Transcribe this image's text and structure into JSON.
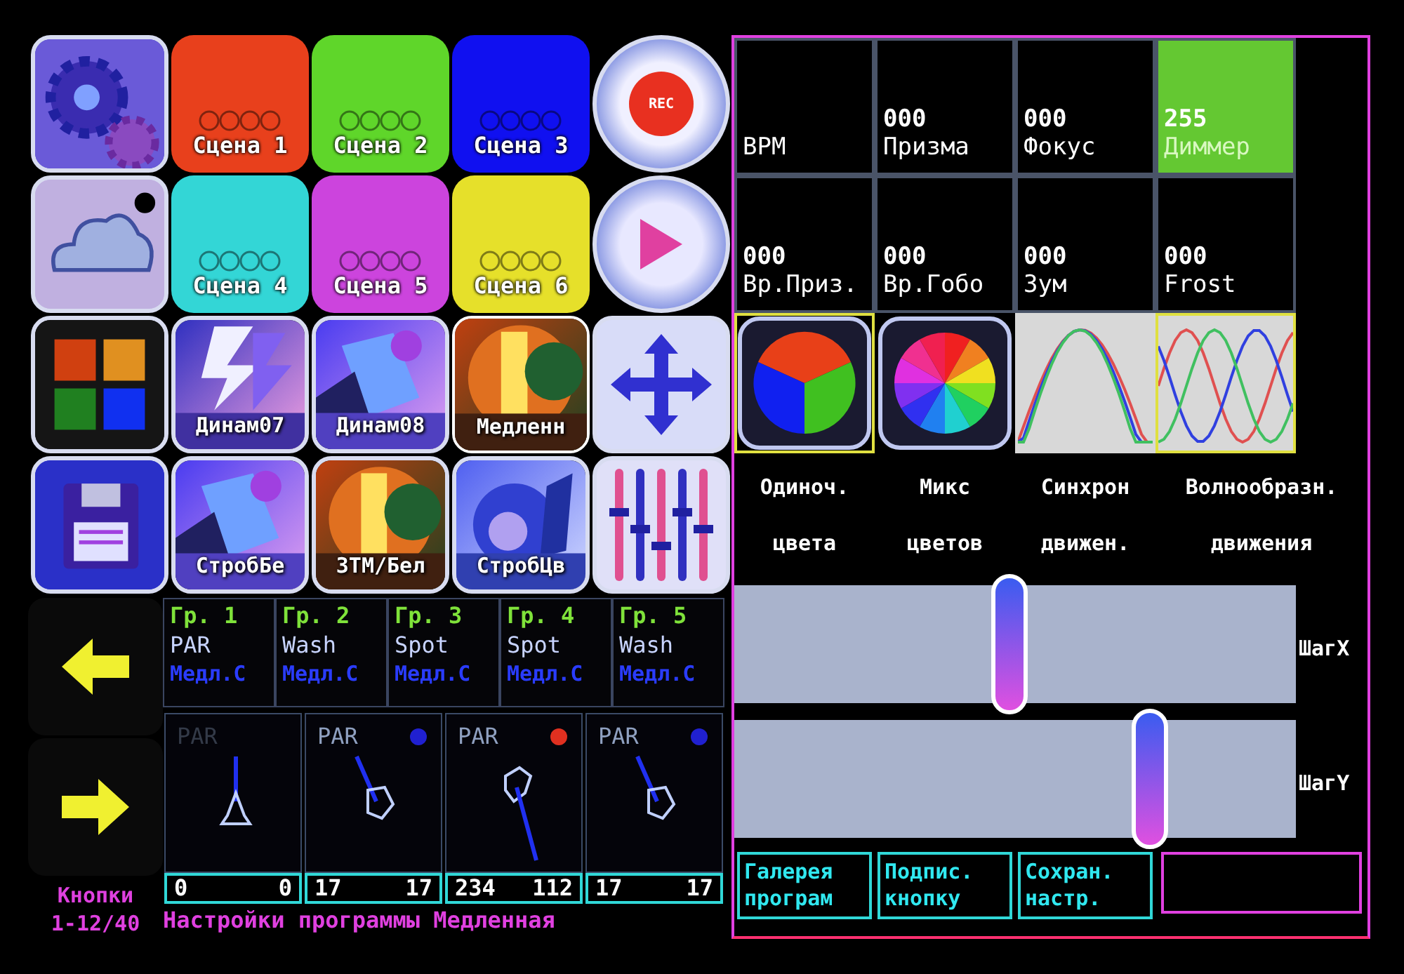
{
  "tiles": [
    {
      "kind": "settings"
    },
    {
      "kind": "scene",
      "label": "Сцена 1",
      "color": "#e8401c"
    },
    {
      "kind": "scene",
      "label": "Сцена 2",
      "color": "#5fd62a"
    },
    {
      "kind": "scene",
      "label": "Сцена 3",
      "color": "#1010f0"
    },
    {
      "kind": "rec",
      "label": "REC"
    },
    {
      "kind": "cloud"
    },
    {
      "kind": "scene",
      "label": "Сцена 4",
      "color": "#33d6d6"
    },
    {
      "kind": "scene",
      "label": "Сцена 5",
      "color": "#cc44dd"
    },
    {
      "kind": "scene",
      "label": "Сцена 6",
      "color": "#e6e02a"
    },
    {
      "kind": "play"
    },
    {
      "kind": "palette"
    },
    {
      "kind": "program",
      "label": "Динам07",
      "selected": false
    },
    {
      "kind": "program",
      "label": "Динам08",
      "selected": false
    },
    {
      "kind": "program",
      "label": "Медленн",
      "selected": true
    },
    {
      "kind": "move"
    },
    {
      "kind": "save"
    },
    {
      "kind": "program",
      "label": "СтробБе",
      "selected": false
    },
    {
      "kind": "program",
      "label": "ЗТМ/Бел",
      "selected": false
    },
    {
      "kind": "program",
      "label": "СтробЦв",
      "selected": false
    },
    {
      "kind": "mixer"
    }
  ],
  "page_label": "Кнопки 1-12/40",
  "groups": [
    {
      "title": "Гр. 1",
      "type": "PAR",
      "program": "Медл.С"
    },
    {
      "title": "Гр. 2",
      "type": "Wash",
      "program": "Медл.С"
    },
    {
      "title": "Гр. 3",
      "type": "Spot",
      "program": "Медл.С"
    },
    {
      "title": "Гр. 4",
      "type": "Spot",
      "program": "Медл.С"
    },
    {
      "title": "Гр. 5",
      "type": "Wash",
      "program": "Медл.С"
    }
  ],
  "channels": [
    {
      "label": "PAR",
      "dimmed": true,
      "pan": "0",
      "tilt": "0"
    },
    {
      "label": "PAR",
      "dimmed": false,
      "color": "#2020d0",
      "pan": "17",
      "tilt": "17"
    },
    {
      "label": "PAR",
      "dimmed": false,
      "color": "#e03020",
      "pan": "234",
      "tilt": "112"
    },
    {
      "label": "PAR",
      "dimmed": false,
      "color": "#2020d0",
      "pan": "17",
      "tilt": "17"
    }
  ],
  "status": "Настройки программы Медленная",
  "params": [
    {
      "label": "BPM",
      "active": false
    },
    {
      "value": "000",
      "label": "Призма",
      "active": false
    },
    {
      "value": "000",
      "label": "Фокус",
      "active": false
    },
    {
      "value": "255",
      "label": "Диммер",
      "active": true
    },
    {
      "value": "000",
      "label": "Вр.Приз.",
      "active": false
    },
    {
      "value": "000",
      "label": "Вр.Гобо",
      "active": false
    },
    {
      "value": "000",
      "label": "Зум",
      "active": false
    },
    {
      "value": "000",
      "label": "Frost",
      "active": false
    }
  ],
  "modes": [
    {
      "kind": "single_color",
      "title": "Одиноч.",
      "subtitle": "цвета",
      "selected": true
    },
    {
      "kind": "mix_color",
      "title": "Микс",
      "subtitle": "цветов",
      "selected": false
    },
    {
      "kind": "sync_wave",
      "title": "Синхрон",
      "subtitle": "движен.",
      "selected": false
    },
    {
      "kind": "wave",
      "title": "Волнообразн.",
      "subtitle": "движения",
      "selected": true
    }
  ],
  "sliders": [
    {
      "label": "ШагX",
      "level": 0.49
    },
    {
      "label": "ШагY",
      "level": 0.74
    }
  ],
  "actions": [
    {
      "label": "Галерея програм"
    },
    {
      "label": "Подпис. кнопку"
    },
    {
      "label": "Сохран. настр."
    }
  ]
}
